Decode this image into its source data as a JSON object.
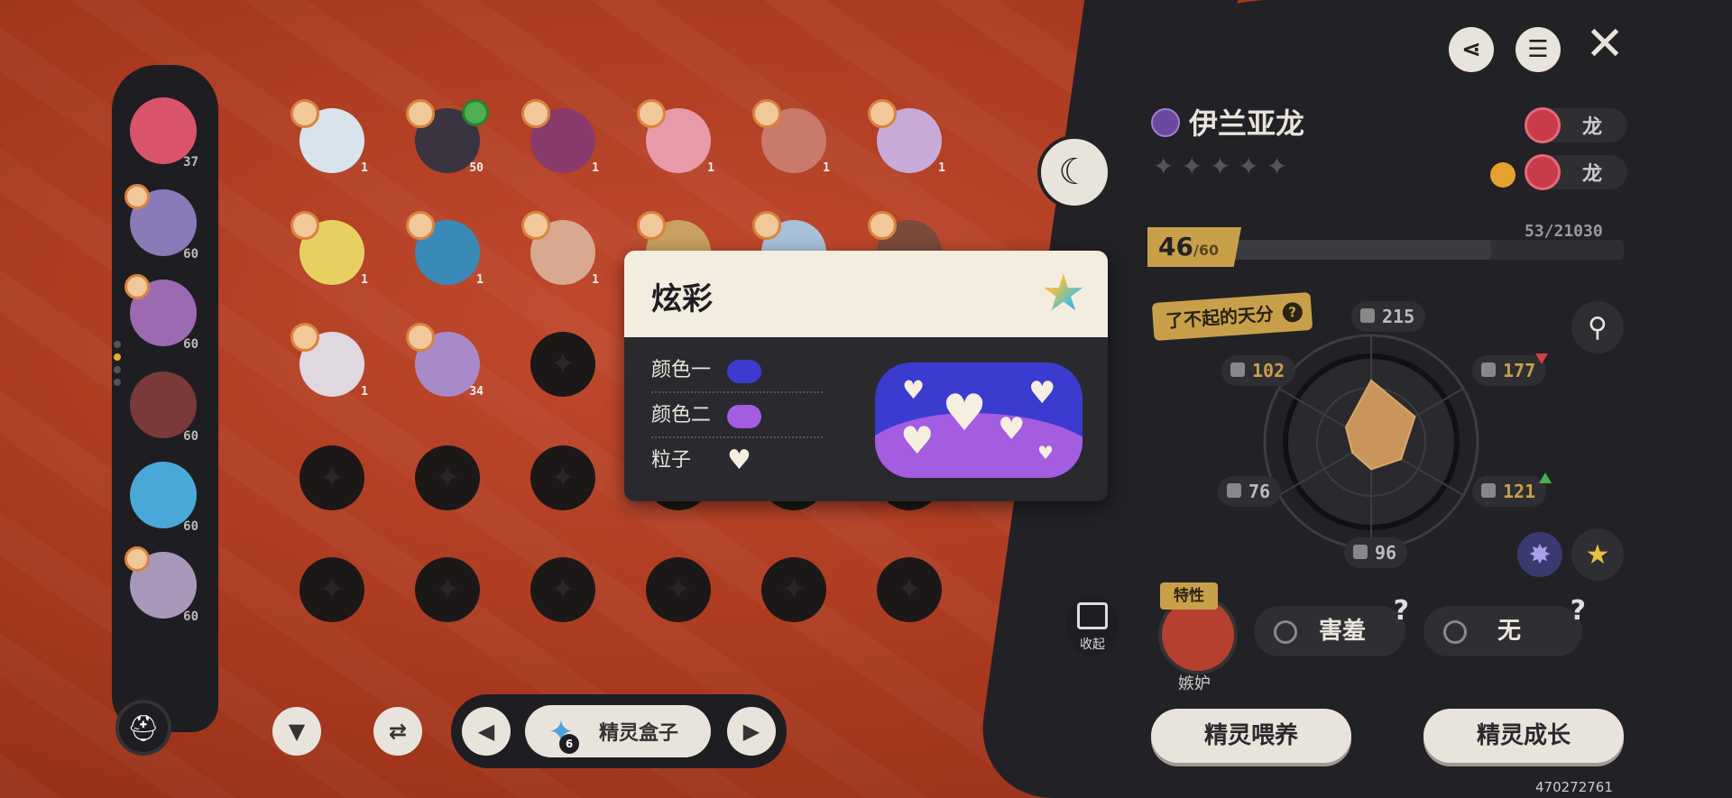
{
  "team": [
    {
      "level": "37",
      "color": "#d9546a"
    },
    {
      "level": "60",
      "color": "#8a7ab8"
    },
    {
      "level": "60",
      "color": "#9c6ab0"
    },
    {
      "level": "60",
      "color": "#7a3a3a"
    },
    {
      "level": "60",
      "color": "#4aa8d8"
    },
    {
      "level": "60",
      "color": "#a897b8"
    }
  ],
  "grid": [
    {
      "level": "1",
      "color": "#d8e4ec"
    },
    {
      "level": "50",
      "color": "#3a3340",
      "has_home": true
    },
    {
      "level": "1",
      "color": "#8a3a6a"
    },
    {
      "level": "1",
      "color": "#e89aa8"
    },
    {
      "level": "1",
      "color": "#c97a6a"
    },
    {
      "level": "1",
      "color": "#c8aad8"
    },
    {
      "level": "1",
      "color": "#e8d060"
    },
    {
      "level": "1",
      "color": "#3a8ab8"
    },
    {
      "level": "1",
      "color": "#d8a890"
    },
    {
      "level": "",
      "color": "#c8a060"
    },
    {
      "level": "",
      "color": "#a8c0d8"
    },
    {
      "level": "",
      "color": "#7a4a3a"
    },
    {
      "level": "1",
      "color": "#e0d8e0"
    },
    {
      "level": "34",
      "color": "#a88ac8"
    }
  ],
  "box": {
    "label": "精灵盒子",
    "count": "6"
  },
  "pet": {
    "name": "伊兰亚龙",
    "types": [
      "龙",
      "龙"
    ],
    "level": "46",
    "level_max": "/60",
    "exp": "53/21030",
    "exp_fraction": 0.72,
    "talent": "了不起的天分",
    "stats": {
      "hp": "215",
      "atk": "102",
      "spatk": "177",
      "def": "76",
      "spdef": "121",
      "spd": "96"
    },
    "trait_label": "特性",
    "trait_name": "嫉妒",
    "skill1": "害羞",
    "skill2": "无",
    "feed_btn": "精灵喂养",
    "grow_btn": "精灵成长",
    "collapse": "收起"
  },
  "popup": {
    "title": "炫彩",
    "color1_label": "颜色一",
    "color1": "#3b3bcf",
    "color2_label": "颜色二",
    "color2": "#a45ce0",
    "particle_label": "粒子",
    "particle": "♥"
  },
  "uid": "470272761"
}
